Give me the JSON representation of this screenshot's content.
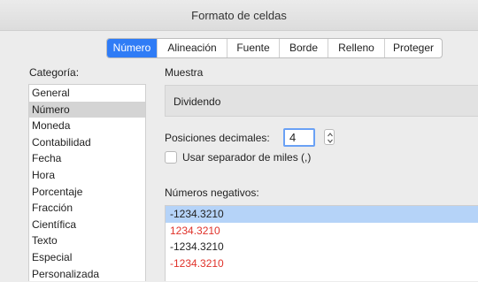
{
  "window": {
    "title": "Formato de celdas"
  },
  "tabs": [
    {
      "label": "Número",
      "active": true
    },
    {
      "label": "Alineación",
      "active": false
    },
    {
      "label": "Fuente",
      "active": false
    },
    {
      "label": "Borde",
      "active": false
    },
    {
      "label": "Relleno",
      "active": false
    },
    {
      "label": "Proteger",
      "active": false
    }
  ],
  "category": {
    "label": "Categoría:",
    "items": [
      "General",
      "Número",
      "Moneda",
      "Contabilidad",
      "Fecha",
      "Hora",
      "Porcentaje",
      "Fracción",
      "Científica",
      "Texto",
      "Especial",
      "Personalizada"
    ],
    "selected": "Número"
  },
  "sample": {
    "label": "Muestra",
    "value": "Dividendo"
  },
  "decimals": {
    "label": "Posiciones decimales:",
    "value": "4"
  },
  "separator": {
    "label": "Usar separador de miles (,)",
    "checked": false
  },
  "negatives": {
    "label": "Números negativos:",
    "items": [
      {
        "text": "-1234.3210",
        "color": "#222222",
        "selected": true
      },
      {
        "text": "1234.3210",
        "color": "#e0322a",
        "selected": false
      },
      {
        "text": "-1234.3210",
        "color": "#222222",
        "selected": false
      },
      {
        "text": "-1234.3210",
        "color": "#e0322a",
        "selected": false
      }
    ]
  }
}
